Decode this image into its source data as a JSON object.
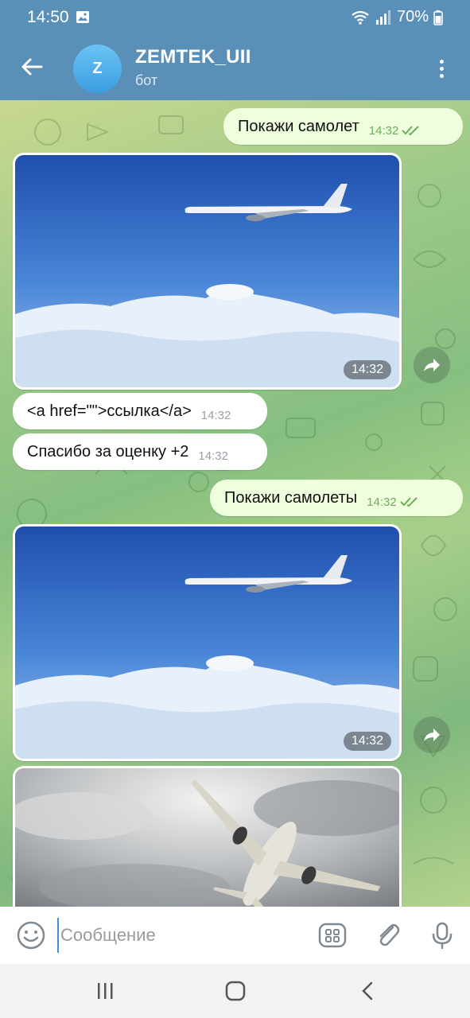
{
  "status": {
    "time": "14:50",
    "battery": "70%"
  },
  "chat": {
    "avatar_letter": "Z",
    "title": "ZEMTEK_UII",
    "subtitle": "бот"
  },
  "messages": [
    {
      "type": "text",
      "direction": "out",
      "text": "Покажи самолет",
      "time": "14:32"
    },
    {
      "type": "photo",
      "direction": "in",
      "subject": "airliner over clouds",
      "time": "14:32"
    },
    {
      "type": "text",
      "direction": "in",
      "text": "<a href=\"\">ссылка</a>",
      "time": "14:32"
    },
    {
      "type": "text",
      "direction": "in",
      "text": "Спасибо за оценку +2",
      "time": "14:32"
    },
    {
      "type": "text",
      "direction": "out",
      "text": "Покажи самолеты",
      "time": "14:32"
    },
    {
      "type": "photo",
      "direction": "in",
      "subject": "airliner over clouds",
      "time": "14:32"
    },
    {
      "type": "photo",
      "direction": "in",
      "subject": "airliner taking off in cloudy sky",
      "time": ""
    }
  ],
  "input": {
    "placeholder": "Сообщение"
  },
  "icons": {
    "back": "arrow-left-icon",
    "menu": "more-vertical-icon",
    "share": "share-icon",
    "emoji": "smile-icon",
    "bot_menu": "grid-icon",
    "attach": "paperclip-icon",
    "mic": "microphone-icon",
    "nav_recents": "recents-icon",
    "nav_home": "home-icon",
    "nav_back": "back-icon"
  },
  "colors": {
    "header": "#5a8fb8",
    "outgoing_bubble": "#effedd",
    "incoming_bubble": "#ffffff",
    "read_ticks": "#6fae5c"
  }
}
